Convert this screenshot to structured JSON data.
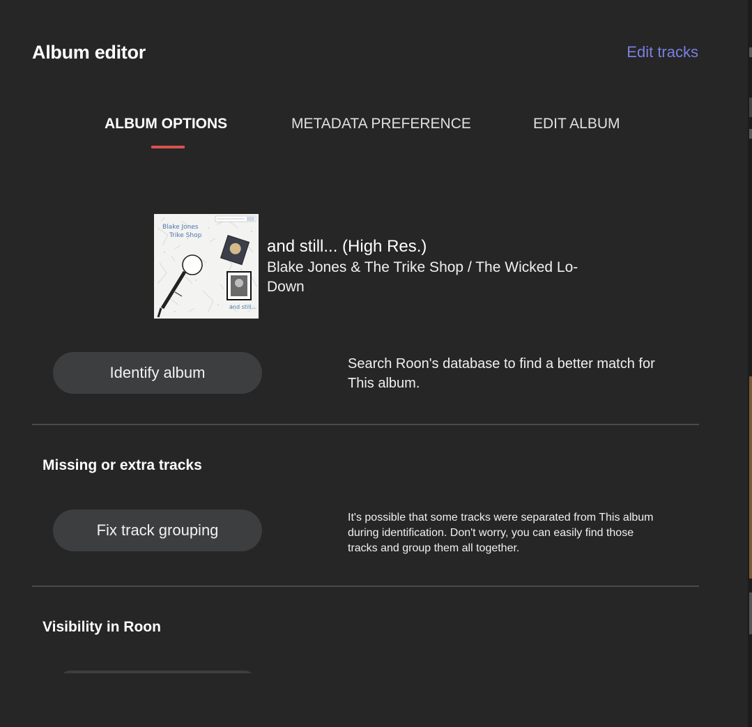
{
  "dialog": {
    "title": "Album editor",
    "edit_tracks_link": "Edit tracks"
  },
  "tabs": [
    {
      "label": "ALBUM OPTIONS",
      "active": true
    },
    {
      "label": "METADATA PREFERENCE",
      "active": false
    },
    {
      "label": "EDIT ALBUM",
      "active": false
    }
  ],
  "album": {
    "title": "and still... (High Res.)",
    "artist": "Blake Jones & The Trike Shop / The Wicked Lo-Down",
    "cover": {
      "band_text": "Blake Jones\nTrike Shop",
      "album_text": "and still..."
    }
  },
  "identify": {
    "button_label": "Identify album",
    "description": "Search Roon's database to find a better match for This album."
  },
  "missing_tracks": {
    "heading": "Missing or extra tracks",
    "button_label": "Fix track grouping",
    "description": "It's possible that some tracks were separated from This album during identification. Don't worry, you can easily find those tracks and group them all together."
  },
  "visibility": {
    "heading": "Visibility in Roon"
  },
  "colors": {
    "background": "#262626",
    "accent_link": "#7b7fe0",
    "tab_underline": "#d9534a",
    "button_bg": "#3d3e40"
  }
}
